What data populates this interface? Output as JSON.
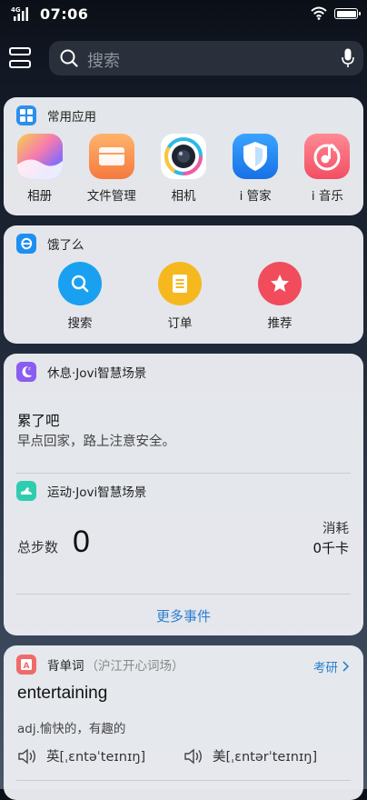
{
  "status": {
    "network": "4G",
    "time": "07:06"
  },
  "search": {
    "placeholder": "搜索"
  },
  "frequent": {
    "title": "常用应用",
    "apps": [
      {
        "label": "相册",
        "icon": "album-icon"
      },
      {
        "label": "文件管理",
        "icon": "file-manager-icon"
      },
      {
        "label": "相机",
        "icon": "camera-icon"
      },
      {
        "label": "i 管家",
        "icon": "shield-icon"
      },
      {
        "label": "i 音乐",
        "icon": "music-icon"
      }
    ]
  },
  "eleme": {
    "title": "饿了么",
    "actions": [
      {
        "label": "搜索",
        "icon": "search-icon",
        "color": "#1aa0f0"
      },
      {
        "label": "订单",
        "icon": "order-icon",
        "color": "#f5b81f"
      },
      {
        "label": "推荐",
        "icon": "star-icon",
        "color": "#f04c5c"
      }
    ]
  },
  "jovi": {
    "rest": {
      "title": "休息·Jovi智慧场景",
      "heading": "累了吧",
      "text": "早点回家，路上注意安全。"
    },
    "sport": {
      "title": "运动·Jovi智慧场景",
      "steps_label": "总步数",
      "steps": "0",
      "calorie_label": "消耗",
      "calorie_value": "0千卡"
    },
    "more": "更多事件"
  },
  "vocab": {
    "title": "背单词",
    "subtitle": "（沪江开心词场）",
    "tag": "考研",
    "word": "entertaining",
    "meaning": "adj.愉快的，有趣的",
    "uk": "英[ˌɛntəˈteɪnɪŋ]",
    "us": "美[ˌɛntərˈteɪnɪŋ]"
  },
  "colors": {
    "accent": "#2a7fd0"
  }
}
